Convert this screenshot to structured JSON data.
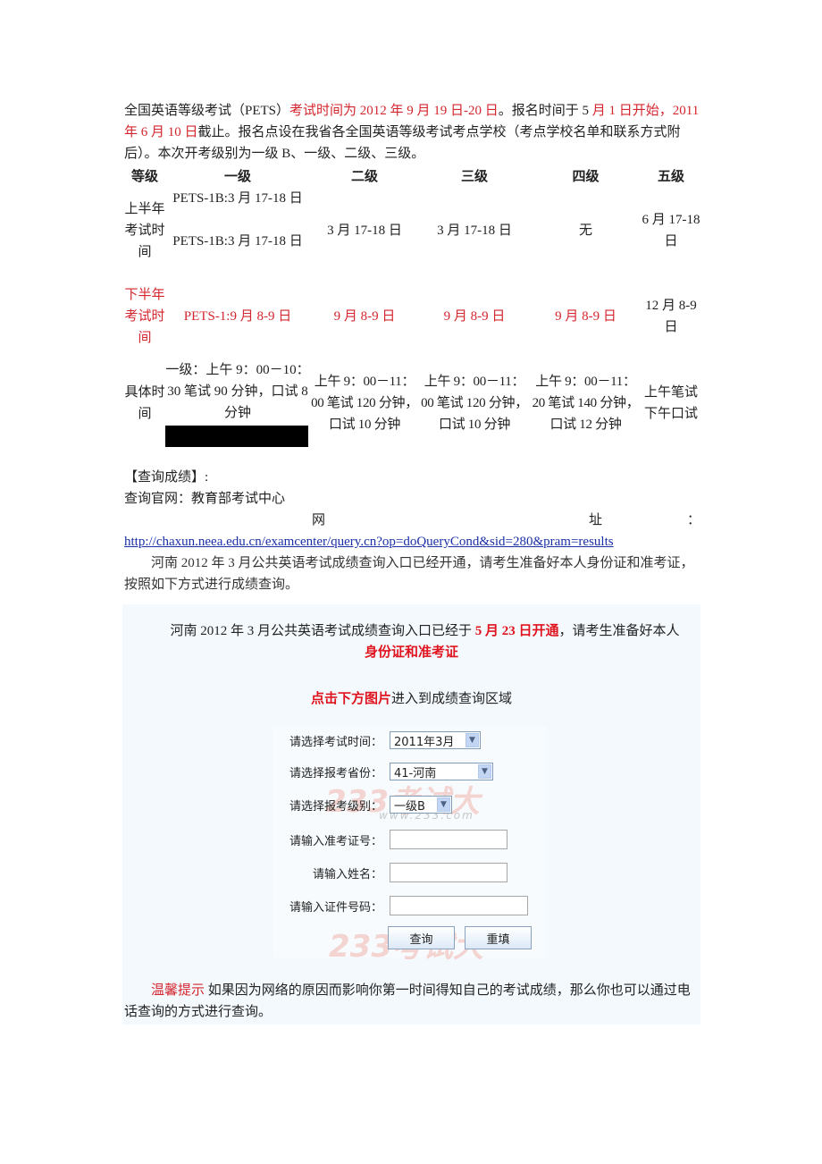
{
  "intro": {
    "part1": "全国英语等级考试（PETS）",
    "part2_red": "考试时间为 2012 年 9 月 19 日-20 日",
    "part3": "。报名时间于 5 ",
    "part4_red": "月 1 日开始，2011 年 6 月 10 日",
    "part5": "截止。报名点设在我省各全国英语等级考试考点学校（考点学校名单和联系方式附后）。本次开考级别为一级 B、一级、二级、三级。"
  },
  "table": {
    "headers": [
      "等级",
      "一级",
      "二级",
      "三级",
      "四级",
      "五级"
    ],
    "rows": [
      {
        "label": "上半年考试时间",
        "level1": [
          "PETS-1B:3 月 17-18 日",
          "PETS-1B:3 月 17-18 日"
        ],
        "level2": "3 月 17-18 日",
        "level3": "3 月 17-18 日",
        "level4": "无",
        "level5": "6 月 17-18 日",
        "highlight": false
      },
      {
        "label": "下半年考试时间",
        "level1": "PETS-1:9 月 8-9 日",
        "level2": "9 月 8-9 日",
        "level3": "9 月 8-9 日",
        "level4": "9 月 8-9 日",
        "level5": "12 月 8-9 日",
        "highlight": true
      },
      {
        "label": "具体时间",
        "level1": "一级：上午 9：00－10：30 笔试 90 分钟，口试 8 分钟",
        "level2": "上午 9：00－11：00 笔试 120 分钟，口试 10 分钟",
        "level3": "上午 9：00－11：00 笔试 120 分钟，口试 10 分钟",
        "level4": "上午 9：00－11：20 笔试 140 分钟，口试 12 分钟",
        "level5": "上午笔试 下午口试",
        "highlight": false
      }
    ]
  },
  "query": {
    "heading": "【查询成绩】:",
    "official_site": "查询官网：教育部考试中心",
    "url_label_a": "网",
    "url_label_b": "址",
    "url_label_c": "：",
    "url": "http://chaxun.neea.edu.cn/examcenter/query.cn?op=doQueryCond&sid=280&pram=results",
    "paragraph": "河南 2012 年 3 月公共英语考试成绩查询入口已经开通，请考生准备好本人身份证和准考证，按照如下方式进行成绩查询。"
  },
  "notice": {
    "line1_a": "河南 2012 年 3 月公共英语考试成绩查询入口已经于 ",
    "line1_red": "5 月 23 日开通",
    "line1_b": "，请考生准备好本人",
    "line2_red": "身份证和准考证",
    "click_red": "点击下方图片",
    "click_rest": "进入到成绩查询区域",
    "tip_red": "温馨提示",
    "tip_text": " 如果因为网络的原因而影响你第一时间得知自己的考试成绩，那么你也可以通过电话查询的方式进行查询。"
  },
  "form": {
    "exam_time_label": "请选择考试时间：",
    "exam_time_value": "2011年3月",
    "province_label": "请选择报考省份：",
    "province_value": "41-河南",
    "level_label": "请选择报考级别：",
    "level_value": "一级B",
    "ticket_label": "请输入准考证号：",
    "ticket_value": "",
    "name_label": "请输入姓名：",
    "name_value": "",
    "id_label": "请输入证件号码：",
    "id_value": "",
    "query_button": "查询",
    "reset_button": "重填",
    "watermark": "233考试大",
    "watermark_url": "www.233.com"
  }
}
